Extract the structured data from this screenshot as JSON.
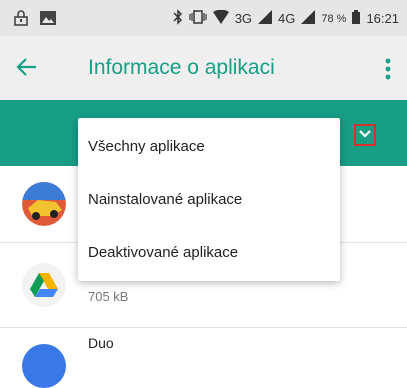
{
  "status_bar": {
    "network_label": "3G",
    "network_label_2": "4G",
    "battery": "78 %",
    "time": "16:21"
  },
  "app_bar": {
    "title": "Informace o aplikaci"
  },
  "dropdown": {
    "items": [
      {
        "label": "Všechny aplikace"
      },
      {
        "label": "Nainstalované aplikace"
      },
      {
        "label": "Deaktivované aplikace"
      }
    ]
  },
  "apps": [
    {
      "name": "",
      "size": ""
    },
    {
      "name": "",
      "size": "705 kB"
    },
    {
      "name": "Duo",
      "size": ""
    }
  ],
  "colors": {
    "accent": "#16a085",
    "teal_bar": "#179e85",
    "highlight_border": "#d9302c"
  }
}
